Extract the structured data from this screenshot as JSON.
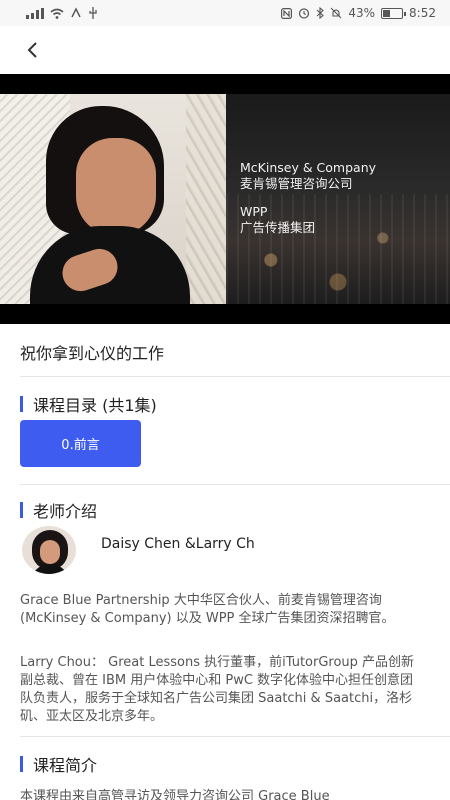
{
  "status_bar": {
    "left_icons": [
      "signal-icon",
      "wifi-icon",
      "nfc-icon",
      "usb-icon"
    ],
    "battery_percent": "43%",
    "battery_level": 0.43,
    "time": "8:52"
  },
  "video": {
    "overlay": {
      "line1": "McKinsey & Company",
      "line2": "麦肯锡管理咨询公司",
      "line3": "WPP",
      "line4": "广告传播集团"
    }
  },
  "course": {
    "title": "祝你拿到心仪的工作"
  },
  "catalog": {
    "heading": "课程目录 (共1集)",
    "episodes": [
      {
        "label": "0.前言"
      }
    ]
  },
  "teacher": {
    "heading": "老师介绍",
    "name": "Daisy Chen &Larry Ch",
    "bio1": "Grace Blue Partnership 大中华区合伙人、前麦肯锡管理咨询 (McKinsey & Company) 以及 WPP 全球广告集团资深招聘官。",
    "bio2": "Larry Chou： Great Lessons 执行董事，前iTutorGroup 产品创新副总裁、曾在 IBM 用户体验中心和 PwC 数字化体验中心担任创意团队负责人，服务于全球知名广告公司集团 Saatchi & Saatchi，洛杉矶、亚太区及北京多年。"
  },
  "intro": {
    "heading": "课程简介",
    "text": "本课程由来自高管寻访及领导力咨询公司 Grace Blue"
  },
  "colors": {
    "accent": "#3e5cf0",
    "section_bar": "#3b5be0"
  }
}
